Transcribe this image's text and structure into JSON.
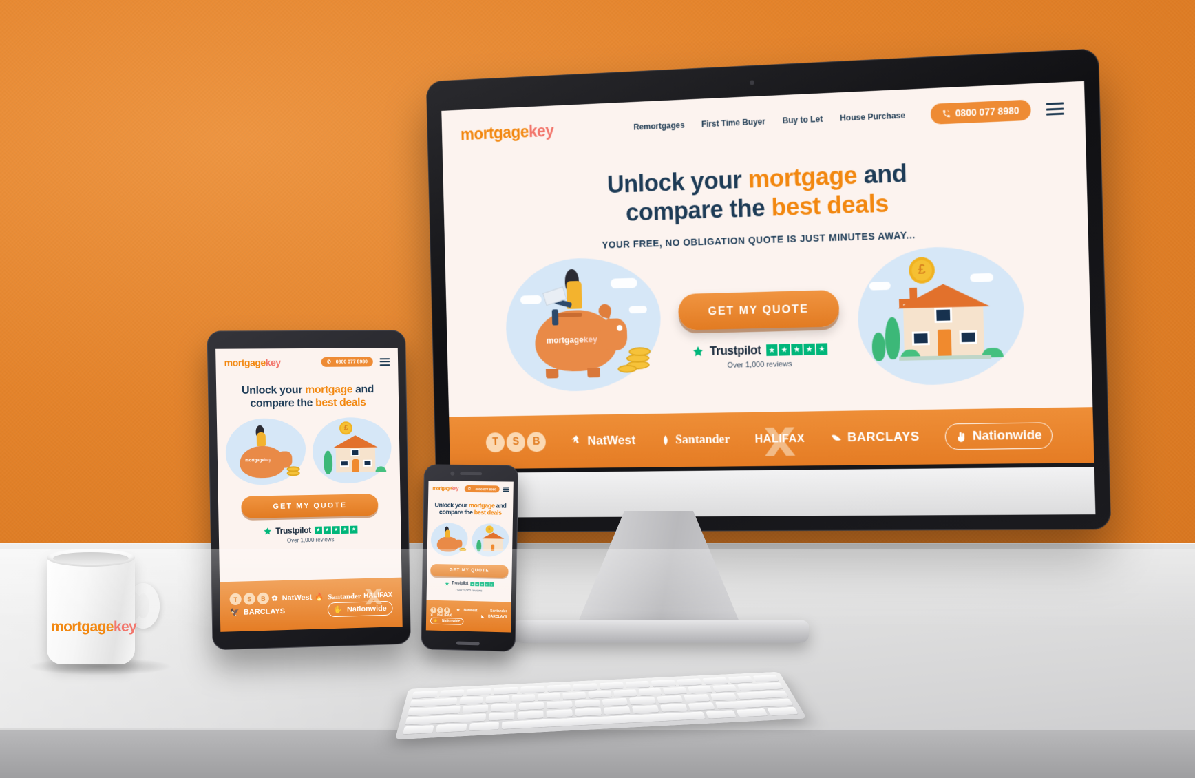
{
  "scene": {
    "description": "Responsive website mockup on iMac, iPad and iPhone on a desk with branded mug",
    "wall_color": "#E4832A",
    "desk_color": "#DCDCDE"
  },
  "brand": {
    "name_part1": "mortgage",
    "name_part2": "key",
    "color_primary": "#F2870F",
    "color_secondary": "#F2756B",
    "color_navy": "#1D3B56",
    "color_cta": "#E8862A"
  },
  "site": {
    "header": {
      "logo_part1": "mortgage",
      "logo_part2": "key",
      "nav": [
        {
          "label": "Remortgages"
        },
        {
          "label": "First Time Buyer"
        },
        {
          "label": "Buy to Let"
        },
        {
          "label": "House Purchase"
        }
      ],
      "phone": "0800 077 8980",
      "phone_icon": "phone-icon",
      "menu_icon": "hamburger-menu-icon"
    },
    "hero": {
      "heading_line1_a": "Unlock your ",
      "heading_line1_hl": "mortgage",
      "heading_line1_b": " and",
      "heading_line2_a": "compare the ",
      "heading_line2_hl": "best deals",
      "subheading": "YOUR FREE, NO OBLIGATION QUOTE IS JUST MINUTES AWAY...",
      "cta_label": "GET MY QUOTE",
      "piggy_label_a": "mortgage",
      "piggy_label_b": "key",
      "coin_symbol": "£"
    },
    "trustpilot": {
      "star_icon": "star-icon",
      "name": "Trustpilot",
      "stars": 5,
      "reviews": "Over 1,000 reviews",
      "star_color": "#00B67A"
    },
    "banks": [
      {
        "name": "TSB",
        "letters": [
          "T",
          "S",
          "B"
        ]
      },
      {
        "name": "NatWest",
        "icon": "natwest-logo-icon"
      },
      {
        "name": "Santander",
        "icon": "santander-flame-icon"
      },
      {
        "name": "HALIFAX",
        "icon": "halifax-x-icon"
      },
      {
        "name": "BARCLAYS",
        "icon": "barclays-eagle-icon"
      },
      {
        "name": "Nationwide",
        "icon": "nationwide-hand-icon"
      }
    ]
  },
  "mug": {
    "logo_part1": "mortgage",
    "logo_part2": "key"
  },
  "devices": {
    "desktop": "imac-desktop",
    "tablet": "ipad-tablet",
    "phone": "iphone-mobile",
    "keyboard": "apple-keyboard"
  }
}
